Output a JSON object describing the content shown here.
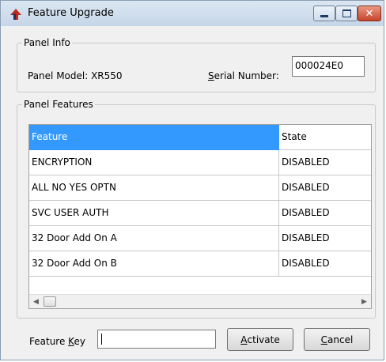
{
  "window": {
    "title": "Feature Upgrade",
    "icon": "red-arrow-app-icon",
    "controls": {
      "minimize": "minimize-icon",
      "maximize": "maximize-icon",
      "close": "close-icon"
    }
  },
  "panel_info": {
    "legend": "Panel Info",
    "model_label": "Panel Model: XR550",
    "serial_label_first": "S",
    "serial_label_rest": "erial Number:",
    "serial_value": "000024E0"
  },
  "panel_features": {
    "legend": "Panel Features",
    "columns": [
      "Feature",
      "State"
    ],
    "rows": [
      {
        "feature": "ENCRYPTION",
        "state": "DISABLED"
      },
      {
        "feature": "ALL NO YES OPTN",
        "state": "DISABLED"
      },
      {
        "feature": "SVC USER AUTH",
        "state": "DISABLED"
      },
      {
        "feature": "32 Door Add On A",
        "state": "DISABLED"
      },
      {
        "feature": "32 Door Add On B",
        "state": "DISABLED"
      }
    ]
  },
  "footer": {
    "key_label_start": "Feature ",
    "key_label_underlined": "K",
    "key_label_end": "ey",
    "key_value": "",
    "activate_underlined": "A",
    "activate_rest": "ctivate",
    "cancel_underlined": "C",
    "cancel_rest": "ancel"
  },
  "colors": {
    "selection": "#3399ff",
    "close_button": "#c7452a"
  }
}
